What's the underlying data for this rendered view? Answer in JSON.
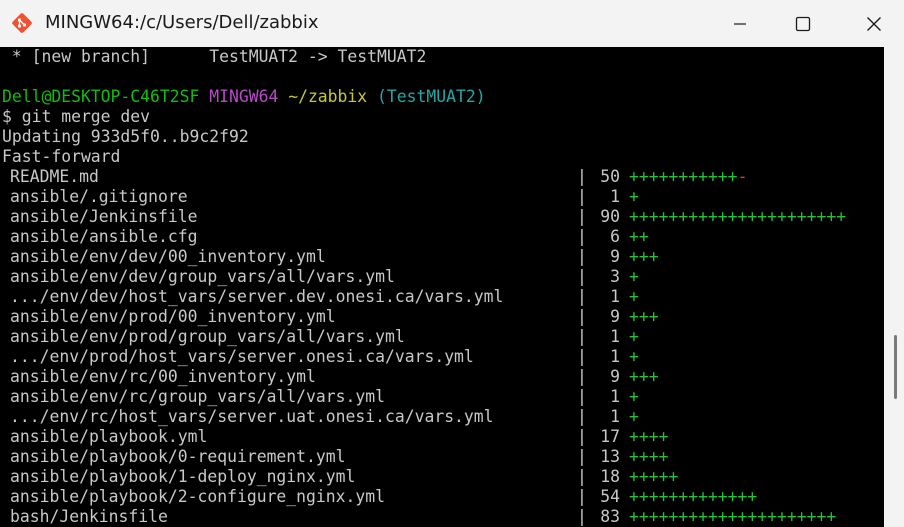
{
  "window": {
    "title": "MINGW64:/c/Users/Dell/zabbix"
  },
  "terminal": {
    "branch_line": " * [new branch]      TestMUAT2 -> TestMUAT2",
    "prompt": {
      "user_host": "Dell@DESKTOP-C46T2SF",
      "system": "MINGW64",
      "path": "~/zabbix",
      "branch": "(TestMUAT2)"
    },
    "command": "$ git merge dev",
    "updating": "Updating 933d5f0..b9c2f92",
    "fast_forward": "Fast-forward",
    "stats": [
      {
        "file": "README.md",
        "count": "50",
        "plus": "+++++++++++",
        "minus": "-"
      },
      {
        "file": "ansible/.gitignore",
        "count": "1",
        "plus": "+",
        "minus": ""
      },
      {
        "file": "ansible/Jenkinsfile",
        "count": "90",
        "plus": "++++++++++++++++++++++",
        "minus": ""
      },
      {
        "file": "ansible/ansible.cfg",
        "count": "6",
        "plus": "++",
        "minus": ""
      },
      {
        "file": "ansible/env/dev/00_inventory.yml",
        "count": "9",
        "plus": "+++",
        "minus": ""
      },
      {
        "file": "ansible/env/dev/group_vars/all/vars.yml",
        "count": "3",
        "plus": "+",
        "minus": ""
      },
      {
        "file": ".../env/dev/host_vars/server.dev.onesi.ca/vars.yml",
        "count": "1",
        "plus": "+",
        "minus": ""
      },
      {
        "file": "ansible/env/prod/00_inventory.yml",
        "count": "9",
        "plus": "+++",
        "minus": ""
      },
      {
        "file": "ansible/env/prod/group_vars/all/vars.yml",
        "count": "1",
        "plus": "+",
        "minus": ""
      },
      {
        "file": ".../env/prod/host_vars/server.onesi.ca/vars.yml",
        "count": "1",
        "plus": "+",
        "minus": ""
      },
      {
        "file": "ansible/env/rc/00_inventory.yml",
        "count": "9",
        "plus": "+++",
        "minus": ""
      },
      {
        "file": "ansible/env/rc/group_vars/all/vars.yml",
        "count": "1",
        "plus": "+",
        "minus": ""
      },
      {
        "file": ".../env/rc/host_vars/server.uat.onesi.ca/vars.yml",
        "count": "1",
        "plus": "+",
        "minus": ""
      },
      {
        "file": "ansible/playbook.yml",
        "count": "17",
        "plus": "++++",
        "minus": ""
      },
      {
        "file": "ansible/playbook/0-requirement.yml",
        "count": "13",
        "plus": "++++",
        "minus": ""
      },
      {
        "file": "ansible/playbook/1-deploy_nginx.yml",
        "count": "18",
        "plus": "+++++",
        "minus": ""
      },
      {
        "file": "ansible/playbook/2-configure_nginx.yml",
        "count": "54",
        "plus": "+++++++++++++",
        "minus": ""
      },
      {
        "file": "bash/Jenkinsfile",
        "count": "83",
        "plus": "+++++++++++++++++++++",
        "minus": ""
      }
    ],
    "separator": "|"
  },
  "colors": {
    "prompt_user": "#0fbd0f",
    "prompt_system": "#b849c9",
    "prompt_path": "#c8c838",
    "prompt_branch": "#22a8a8",
    "diff_plus": "#23c43a",
    "diff_minus": "#e23a3a"
  },
  "icons": {
    "app": "git-bash-icon",
    "minimize": "minimize-icon",
    "maximize": "maximize-icon",
    "close": "close-icon"
  }
}
